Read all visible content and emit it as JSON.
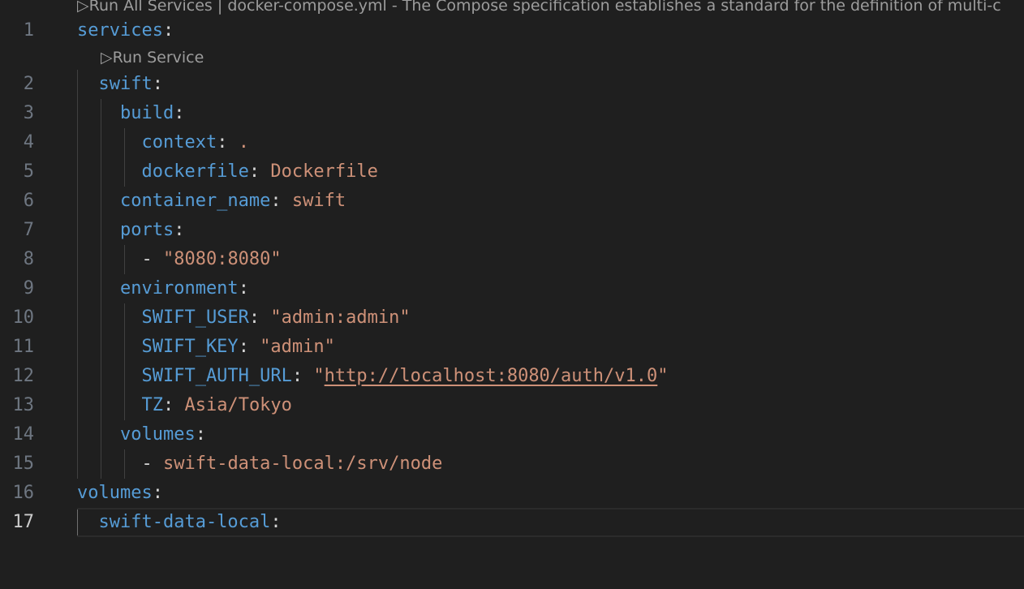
{
  "codelens": {
    "top": {
      "run_all": "Run All Services",
      "separator": "|",
      "schema_info": "docker-compose.yml - The Compose specification establishes a standard for the definition of multi-c"
    },
    "run_service": "Run Service",
    "play_glyph": "▷"
  },
  "active_line": 17,
  "lines": [
    {
      "n": "1",
      "tokens": [
        {
          "t": "services",
          "c": "k"
        },
        {
          "t": ":",
          "c": "p"
        }
      ]
    },
    {
      "n": "2",
      "tokens": [
        {
          "t": "  swift",
          "c": "k"
        },
        {
          "t": ":",
          "c": "p"
        }
      ]
    },
    {
      "n": "3",
      "tokens": [
        {
          "t": "    build",
          "c": "k"
        },
        {
          "t": ":",
          "c": "p"
        }
      ]
    },
    {
      "n": "4",
      "tokens": [
        {
          "t": "      context",
          "c": "k"
        },
        {
          "t": ": ",
          "c": "p"
        },
        {
          "t": ".",
          "c": "s"
        }
      ]
    },
    {
      "n": "5",
      "tokens": [
        {
          "t": "      dockerfile",
          "c": "k"
        },
        {
          "t": ": ",
          "c": "p"
        },
        {
          "t": "Dockerfile",
          "c": "s"
        }
      ]
    },
    {
      "n": "6",
      "tokens": [
        {
          "t": "    container_name",
          "c": "k"
        },
        {
          "t": ": ",
          "c": "p"
        },
        {
          "t": "swift",
          "c": "s"
        }
      ]
    },
    {
      "n": "7",
      "tokens": [
        {
          "t": "    ports",
          "c": "k"
        },
        {
          "t": ":",
          "c": "p"
        }
      ]
    },
    {
      "n": "8",
      "tokens": [
        {
          "t": "      - ",
          "c": "p"
        },
        {
          "t": "\"8080:8080\"",
          "c": "s"
        }
      ]
    },
    {
      "n": "9",
      "tokens": [
        {
          "t": "    environment",
          "c": "k"
        },
        {
          "t": ":",
          "c": "p"
        }
      ]
    },
    {
      "n": "10",
      "tokens": [
        {
          "t": "      SWIFT_USER",
          "c": "k"
        },
        {
          "t": ": ",
          "c": "p"
        },
        {
          "t": "\"admin:admin\"",
          "c": "s"
        }
      ]
    },
    {
      "n": "11",
      "tokens": [
        {
          "t": "      SWIFT_KEY",
          "c": "k"
        },
        {
          "t": ": ",
          "c": "p"
        },
        {
          "t": "\"admin\"",
          "c": "s"
        }
      ]
    },
    {
      "n": "12",
      "tokens": [
        {
          "t": "      SWIFT_AUTH_URL",
          "c": "k"
        },
        {
          "t": ": ",
          "c": "p"
        },
        {
          "t": "\"",
          "c": "s"
        },
        {
          "t": "http://localhost:8080/auth/v1.0",
          "c": "u"
        },
        {
          "t": "\"",
          "c": "s"
        }
      ]
    },
    {
      "n": "13",
      "tokens": [
        {
          "t": "      TZ",
          "c": "k"
        },
        {
          "t": ": ",
          "c": "p"
        },
        {
          "t": "Asia/Tokyo",
          "c": "s"
        }
      ]
    },
    {
      "n": "14",
      "tokens": [
        {
          "t": "    volumes",
          "c": "k"
        },
        {
          "t": ":",
          "c": "p"
        }
      ]
    },
    {
      "n": "15",
      "tokens": [
        {
          "t": "      - ",
          "c": "p"
        },
        {
          "t": "swift-data-local:/srv/node",
          "c": "s"
        }
      ]
    },
    {
      "n": "16",
      "tokens": [
        {
          "t": "volumes",
          "c": "k"
        },
        {
          "t": ":",
          "c": "p"
        }
      ]
    },
    {
      "n": "17",
      "tokens": [
        {
          "t": "  swift-data-local",
          "c": "k"
        },
        {
          "t": ":",
          "c": "p"
        }
      ]
    }
  ],
  "colors": {
    "background": "#1f1f1f",
    "key": "#569cd6",
    "string": "#ce9178",
    "punctuation": "#d4d4d4",
    "line_number": "#6e7681",
    "active_line_number": "#cccccc",
    "codelens": "#9d9d9d"
  }
}
